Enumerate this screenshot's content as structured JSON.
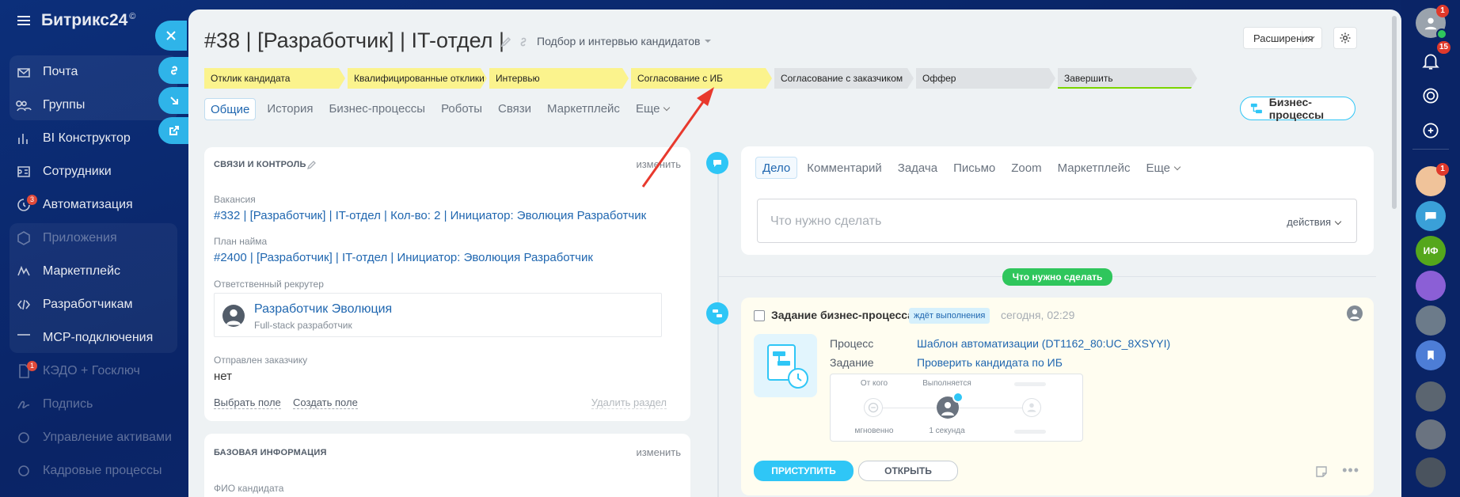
{
  "app": {
    "brand": "Битрикс24",
    "brand_mark": "©"
  },
  "left_menu": [
    {
      "label": "Почта",
      "icon": "mail-icon"
    },
    {
      "label": "Группы",
      "icon": "groups-icon"
    },
    {
      "label": "BI Конструктор",
      "icon": "chart-icon"
    },
    {
      "label": "Сотрудники",
      "icon": "employees-icon"
    },
    {
      "label": "Автоматизация",
      "icon": "automation-icon",
      "badge": "3"
    },
    {
      "label": "Приложения",
      "icon": "apps-icon",
      "dim": true
    },
    {
      "label": "Маркетплейс",
      "icon": "marketplace-icon"
    },
    {
      "label": "Разработчикам",
      "icon": "code-icon"
    },
    {
      "label": "MCP-подключения",
      "icon": "mcp-icon"
    },
    {
      "label": "КЭДО + Госключ",
      "icon": "document-icon",
      "badge": "1",
      "dim": true
    },
    {
      "label": "Подпись",
      "icon": "signature-icon",
      "dim": true
    },
    {
      "label": "Управление активами",
      "icon": "assets-icon",
      "dim": true
    },
    {
      "label": "Кадровые процессы",
      "icon": "hr-icon",
      "dim": true
    }
  ],
  "right_bar": {
    "avatar_badge": "1",
    "bell_badge": "15",
    "user_badge": "1",
    "initials": "ИФ"
  },
  "header": {
    "title": "#38 | [Разработчик] | IT-отдел |",
    "funnel": "Подбор и интервью кандидатов",
    "extensions": "Расширения"
  },
  "stages": [
    {
      "label": "Отклик кандидата",
      "state": "done"
    },
    {
      "label": "Квалифицированные отклики",
      "state": "done"
    },
    {
      "label": "Интервью",
      "state": "done"
    },
    {
      "label": "Согласование с ИБ",
      "state": "current"
    },
    {
      "label": "Согласование с заказчиком",
      "state": "todo"
    },
    {
      "label": "Оффер",
      "state": "todo"
    },
    {
      "label": "Завершить",
      "state": "final"
    }
  ],
  "tabs": [
    "Общие",
    "История",
    "Бизнес-процессы",
    "Роботы",
    "Связи",
    "Маркетплейс",
    "Еще"
  ],
  "bp_button": "Бизнес-процессы",
  "card1": {
    "header": "СВЯЗИ И КОНТРОЛЬ",
    "edit": "изменить",
    "vacancy_label": "Вакансия",
    "vacancy_value": "#332 | [Разработчик] | IT-отдел | Кол-во: 2 | Инициатор: Эволюция Разработчик",
    "plan_label": "План найма",
    "plan_value": "#2400 | [Разработчик] | IT-отдел | Инициатор: Эволюция Разработчик",
    "recruiter_label": "Ответственный рекрутер",
    "recruiter_name": "Разработчик Эволюция",
    "recruiter_position": "Full-stack разработчик",
    "sent_label": "Отправлен заказчику",
    "sent_value": "нет",
    "choose_field": "Выбрать поле",
    "create_field": "Создать поле",
    "delete_section": "Удалить раздел"
  },
  "card2": {
    "header": "БАЗОВАЯ ИНФОРМАЦИЯ",
    "edit": "изменить",
    "fio_label": "ФИО кандидата"
  },
  "editor": {
    "tabs": [
      "Дело",
      "Комментарий",
      "Задача",
      "Письмо",
      "Zoom",
      "Маркетплейс",
      "Еще"
    ],
    "placeholder": "Что нужно сделать",
    "actions": "действия"
  },
  "todo_pill": "Что нужно сделать",
  "task": {
    "title": "Задание бизнес-процесса",
    "status": "ждёт выполнения",
    "time": "сегодня, 02:29",
    "process_label": "Процесс",
    "process_value": "Шаблон автоматизации (DT1162_80:UC_8XSYYI)",
    "task_label": "Задание",
    "task_value": "Проверить кандидата по ИБ",
    "from_label": "От кого",
    "exec_label": "Выполняется",
    "from_time": "мгновенно",
    "exec_time": "1 секунда",
    "start_btn": "ПРИСТУПИТЬ",
    "open_btn": "ОТКРЫТЬ"
  },
  "colors": {
    "accent": "#2fc6f6",
    "stage_done": "#fbf38d",
    "stage_todo": "#dfe2e5",
    "pill": "#2fc65c",
    "arrow": "#e8392d"
  }
}
